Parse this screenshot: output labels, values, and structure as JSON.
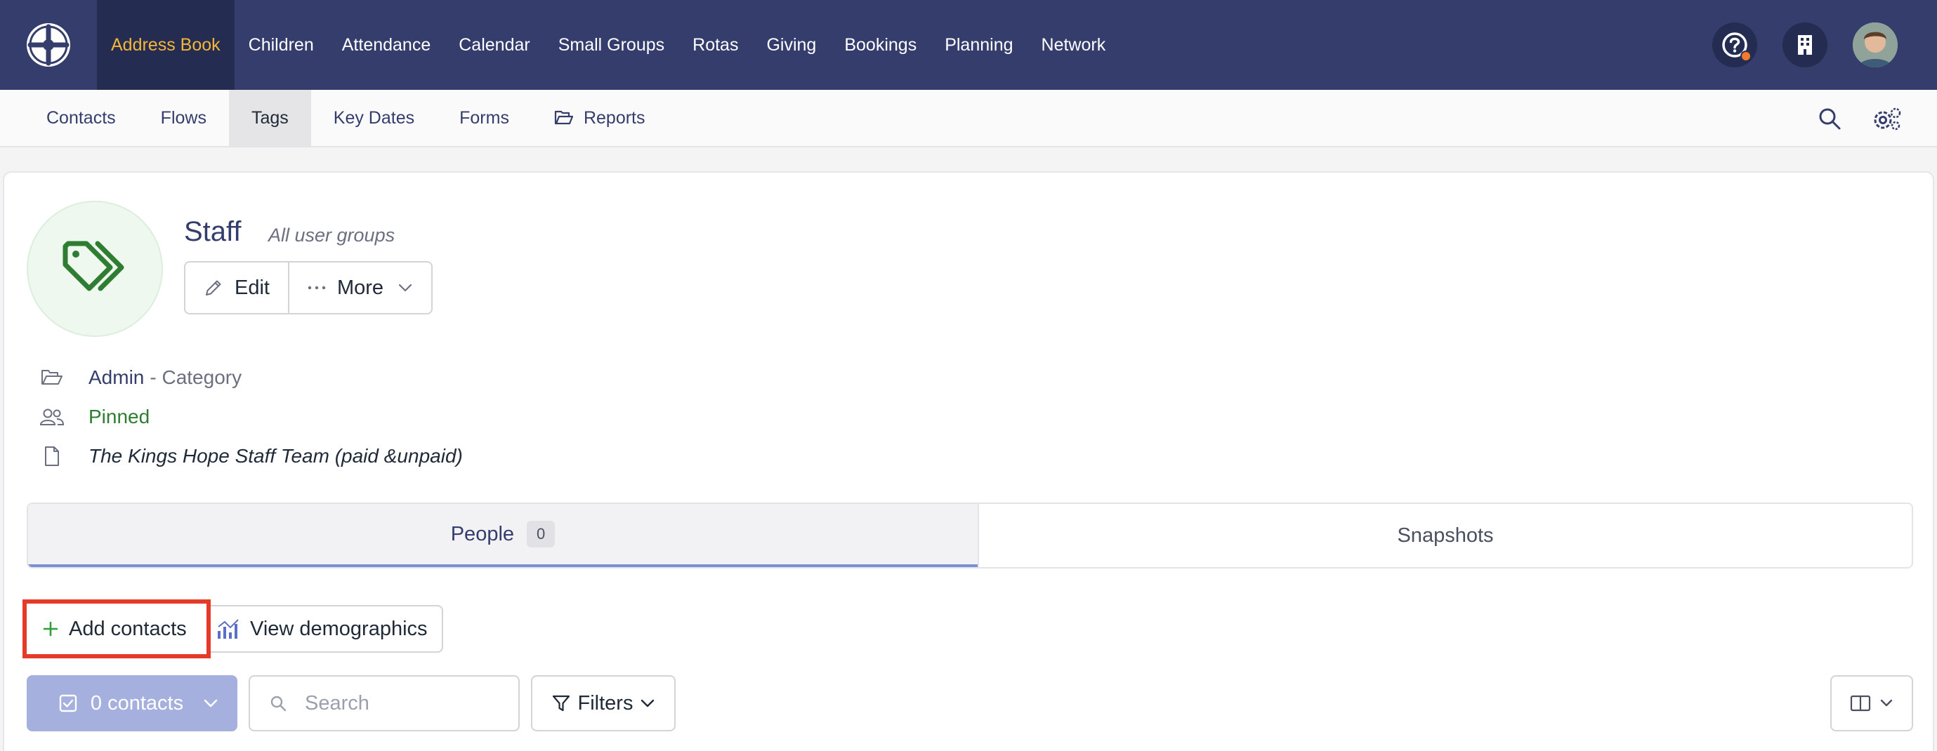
{
  "topnav": {
    "items": [
      "Address Book",
      "Children",
      "Attendance",
      "Calendar",
      "Small Groups",
      "Rotas",
      "Giving",
      "Bookings",
      "Planning",
      "Network"
    ],
    "active_index": 0,
    "accent_color": "#f5b638",
    "background_color": "#343d6b"
  },
  "subnav": {
    "items": [
      "Contacts",
      "Flows",
      "Tags",
      "Key Dates",
      "Forms",
      "Reports"
    ],
    "active_index": 2
  },
  "tag": {
    "title": "Staff",
    "subtitle": "All user groups",
    "edit_label": "Edit",
    "more_label": "More",
    "category_link": "Admin",
    "category_suffix": "- Category",
    "pinned_label": "Pinned",
    "description": "The Kings Hope Staff Team (paid &unpaid)"
  },
  "tabs": {
    "people_label": "People",
    "people_count": "0",
    "snapshots_label": "Snapshots"
  },
  "actions": {
    "add_contacts_label": "Add contacts",
    "view_demographics_label": "View demographics"
  },
  "list_controls": {
    "contacts_count_label": "0 contacts",
    "search_placeholder": "Search",
    "filters_label": "Filters"
  },
  "icons": {
    "logo": "wheel-logo-icon",
    "help": "help-icon",
    "building": "building-icon",
    "search": "search-icon",
    "settings": "gear-icon",
    "tag": "tag-icon"
  }
}
